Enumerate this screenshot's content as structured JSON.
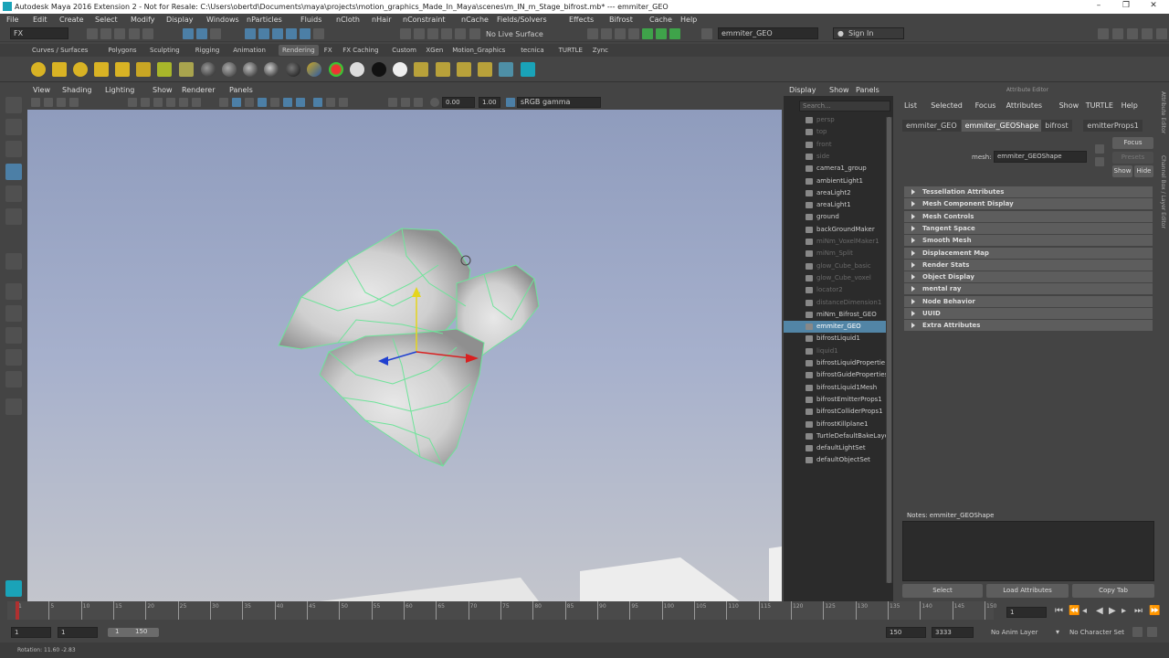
{
  "window": {
    "title": "Autodesk Maya 2016 Extension 2 - Not for Resale: C:\\Users\\obertd\\Documents\\maya\\projects\\motion_graphics_Made_In_Maya\\scenes\\m_IN_m_Stage_bifrost.mb*  ---  emmiter_GEO"
  },
  "menubar": [
    "File",
    "Edit",
    "Create",
    "Select",
    "Modify",
    "Display",
    "Windows",
    "nParticles",
    "Fluids",
    "nCloth",
    "nHair",
    "nConstraint",
    "nCache",
    "Fields/Solvers",
    "Effects",
    "Bifrost",
    "Cache",
    "Help"
  ],
  "statusline": {
    "menuset": "FX",
    "live_surface": "No Live Surface",
    "object_field": "emmiter_GEO",
    "sign_in": "Sign In"
  },
  "shelf_tabs": [
    "Curves / Surfaces",
    "Polygons",
    "Sculpting",
    "Rigging",
    "Animation",
    "Rendering",
    "FX",
    "FX Caching",
    "Custom",
    "XGen",
    "Motion_Graphics",
    "tecnica",
    "TURTLE",
    "Zync"
  ],
  "shelf_active": "Rendering",
  "panel_menu": [
    "View",
    "Shading",
    "Lighting",
    "Show",
    "Renderer",
    "Panels"
  ],
  "panel_tools": {
    "exposure": "0.00",
    "gamma": "1.00",
    "color_space": "sRGB gamma"
  },
  "outliner": {
    "menu": [
      "Display",
      "Show",
      "Panels"
    ],
    "search_placeholder": "Search...",
    "items": [
      {
        "label": "persp",
        "dim": true
      },
      {
        "label": "top",
        "dim": true
      },
      {
        "label": "front",
        "dim": true
      },
      {
        "label": "side",
        "dim": true
      },
      {
        "label": "camera1_group",
        "dim": false
      },
      {
        "label": "ambientLight1",
        "dim": false
      },
      {
        "label": "areaLight2",
        "dim": false
      },
      {
        "label": "areaLight1",
        "dim": false
      },
      {
        "label": "ground",
        "dim": false
      },
      {
        "label": "backGroundMaker",
        "dim": false
      },
      {
        "label": "miNm_VoxelMaker1",
        "dim": true
      },
      {
        "label": "miNm_Split",
        "dim": true
      },
      {
        "label": "glow_Cube_basic",
        "dim": true
      },
      {
        "label": "glow_Cube_voxel",
        "dim": true
      },
      {
        "label": "locator2",
        "dim": true
      },
      {
        "label": "distanceDimension1",
        "dim": true
      },
      {
        "label": "miNm_Bifrost_GEO",
        "dim": false
      },
      {
        "label": "emmiter_GEO",
        "dim": false,
        "selected": true
      },
      {
        "label": "bifrostLiquid1",
        "dim": false
      },
      {
        "label": "liquid1",
        "dim": true
      },
      {
        "label": "bifrostLiquidPropertie",
        "dim": false
      },
      {
        "label": "bifrostGuideProperties",
        "dim": false
      },
      {
        "label": "bifrostLiquid1Mesh",
        "dim": false
      },
      {
        "label": "bifrostEmitterProps1",
        "dim": false
      },
      {
        "label": "bifrostColliderProps1",
        "dim": false
      },
      {
        "label": "bifrostKillplane1",
        "dim": false
      },
      {
        "label": "TurtleDefaultBakeLaye",
        "dim": false
      },
      {
        "label": "defaultLightSet",
        "dim": false
      },
      {
        "label": "defaultObjectSet",
        "dim": false
      }
    ]
  },
  "attribute_editor": {
    "header": "Attribute Editor",
    "menu": [
      "List",
      "Selected",
      "Focus",
      "Attributes",
      "Show",
      "TURTLE",
      "Help"
    ],
    "tabs": [
      "emmiter_GEO",
      "emmiter_GEOShape",
      "bifrost",
      "emitterProps1"
    ],
    "active_tab": "emmiter_GEOShape",
    "mesh_label": "mesh:",
    "mesh_value": "emmiter_GEOShape",
    "focus_btn": "Focus",
    "presets_btn": "Presets",
    "show_btn": "Show",
    "hide_btn": "Hide",
    "sections": [
      "Tessellation Attributes",
      "Mesh Component Display",
      "Mesh Controls",
      "Tangent Space",
      "Smooth Mesh",
      "Displacement Map",
      "Render Stats",
      "Object Display",
      "mental ray",
      "Node Behavior",
      "UUID",
      "Extra Attributes"
    ],
    "notes_label": "Notes:  emmiter_GEOShape",
    "bottom_buttons": [
      "Select",
      "Load Attributes",
      "Copy Tab"
    ],
    "side_tabs": [
      "Attribute Editor",
      "Channel Box / Layer Editor"
    ]
  },
  "timeslider": {
    "ticks": [
      "1",
      "5",
      "10",
      "15",
      "20",
      "25",
      "30",
      "35",
      "40",
      "45",
      "50",
      "55",
      "60",
      "65",
      "70",
      "75",
      "80",
      "85",
      "90",
      "95",
      "100",
      "105",
      "110",
      "115",
      "120",
      "125",
      "130",
      "135",
      "140",
      "145",
      "150"
    ],
    "current_frame": "1"
  },
  "rangeslider": {
    "start": "1",
    "start_inner": "1",
    "range_start_label": "1",
    "range_end_label": "150",
    "end_inner": "150",
    "end": "3333",
    "anim_layer": "No Anim Layer",
    "char_set": "No Character Set"
  },
  "helpline": {
    "text": "Rotation:   11.60   -2.83"
  }
}
